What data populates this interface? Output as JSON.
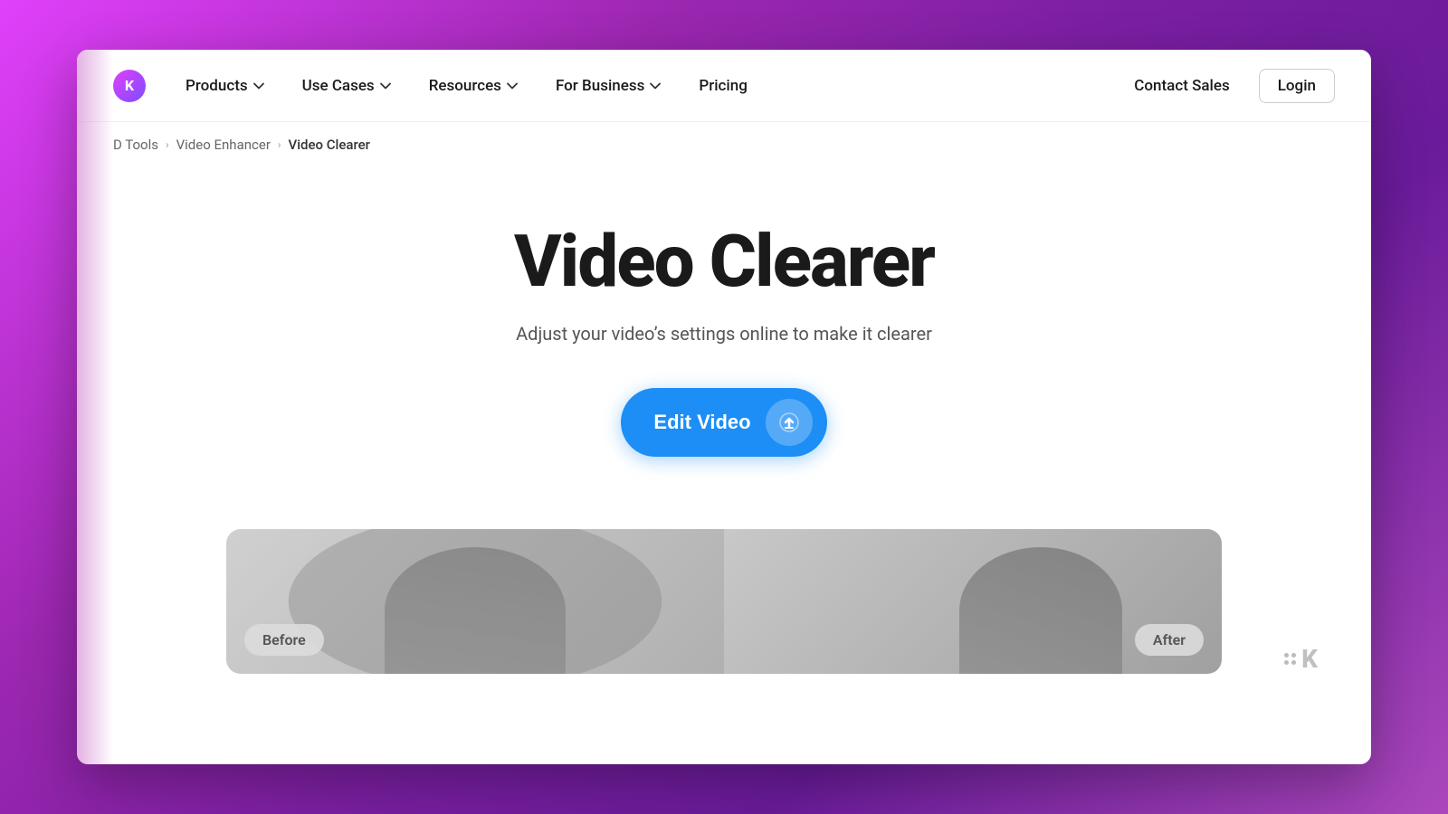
{
  "background": {
    "gradient": "linear-gradient(135deg, #e040fb 0%, #9c27b0 30%, #7b1fa2 50%, #6a1b9a 70%, #ab47bc 100%)"
  },
  "navbar": {
    "logo_letter": "K",
    "nav_items": [
      {
        "label": "Products",
        "has_dropdown": true
      },
      {
        "label": "Use Cases",
        "has_dropdown": true
      },
      {
        "label": "Resources",
        "has_dropdown": true
      },
      {
        "label": "For Business",
        "has_dropdown": true
      },
      {
        "label": "Pricing",
        "has_dropdown": false
      }
    ],
    "contact_sales_label": "Contact Sales",
    "login_label": "Login"
  },
  "breadcrumb": {
    "items": [
      {
        "label": "D Tools",
        "is_active": false
      },
      {
        "label": "Video Enhancer",
        "is_active": false
      },
      {
        "label": "Video Clearer",
        "is_active": true
      }
    ]
  },
  "hero": {
    "title": "Video Clearer",
    "subtitle": "Adjust your video’s settings online to make it clearer",
    "cta_label": "Edit Video",
    "cta_icon": "upload-icon"
  },
  "before_after": {
    "before_label": "Before",
    "after_label": "After"
  },
  "watermark": {
    "letter": "K"
  }
}
